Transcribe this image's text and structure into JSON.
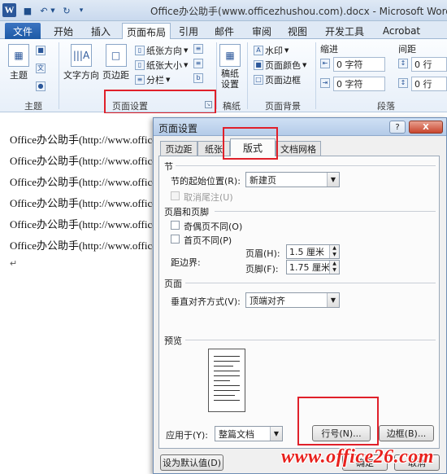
{
  "titlebar": {
    "app_icon": "W",
    "title": "Office办公助手(www.officezhushou.com).docx - Microsoft Word"
  },
  "ribbon_tabs": [
    "文件",
    "开始",
    "插入",
    "页面布局",
    "引用",
    "邮件",
    "审阅",
    "视图",
    "开发工具",
    "Acrobat"
  ],
  "ribbon": {
    "theme_label": "主题",
    "text_direction": "文字方向",
    "margins": "页边距",
    "orientation": "纸张方向",
    "size": "纸张大小",
    "columns": "分栏",
    "manuscript": "稿纸\n设置",
    "watermark": "水印",
    "page_color": "页面颜色",
    "page_borders": "页面边框",
    "indent_label": "缩进",
    "spacing_label": "间距",
    "indent_left": "0 字符",
    "indent_right": "0 字符",
    "spacing_before": "0 行",
    "spacing_after": "0 行",
    "groups": {
      "theme": "主题",
      "page_setup": "页面设置",
      "manuscript": "稿纸",
      "background": "页面背景",
      "paragraph": "段落"
    }
  },
  "document": {
    "lines": [
      "Office办公助手(http://www.office",
      "Office办公助手(http://www.office",
      "Office办公助手(http://www.office",
      "Office办公助手(http://www.office",
      "Office办公助手(http://www.office",
      "Office办公助手(http://www.office"
    ],
    "para_mark": "↵"
  },
  "dialog": {
    "title": "页面设置",
    "help": "?",
    "close": "X",
    "tabs": [
      "页边距",
      "纸张",
      "版式",
      "文档网格"
    ],
    "active_tab": "版式",
    "section_title": "节",
    "section_start_label": "节的起始位置(R):",
    "section_start_value": "新建页",
    "suppress_endnotes": "取消尾注(U)",
    "header_footer_title": "页眉和页脚",
    "odd_even": "奇偶页不同(O)",
    "first_page": "首页不同(P)",
    "from_edge": "距边界:",
    "header_label": "页眉(H):",
    "header_value": "1.5 厘米",
    "footer_label": "页脚(F):",
    "footer_value": "1.75 厘米",
    "page_title": "页面",
    "vertical_align_label": "垂直对齐方式(V):",
    "vertical_align_value": "顶端对齐",
    "preview_title": "预览",
    "apply_to_label": "应用于(Y):",
    "apply_to_value": "整篇文档",
    "line_numbers_btn": "行号(N)...",
    "borders_btn": "边框(B)...",
    "default_btn": "设为默认值(D)",
    "ok_btn": "确定",
    "cancel_btn": "取消"
  },
  "watermark_text": "www.office26.com"
}
